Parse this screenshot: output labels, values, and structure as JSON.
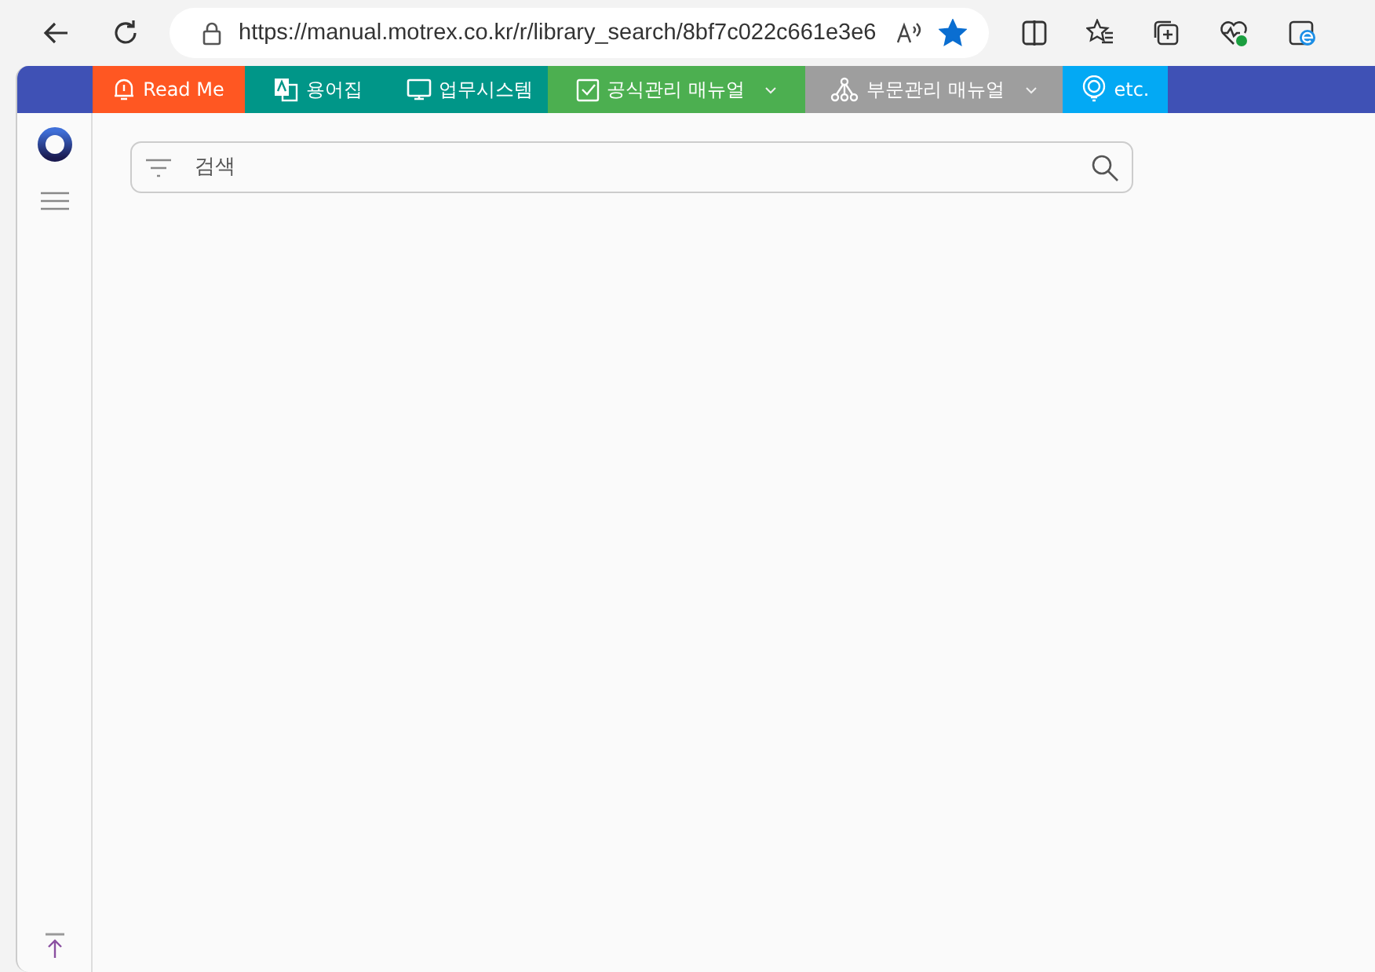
{
  "browser": {
    "url": "https://manual.motrex.co.kr/r/library_search/8bf7c022c661e3e6",
    "favorite": true
  },
  "nav_tabs": [
    {
      "label": "Read Me",
      "color": "#ff5722",
      "dropdown": false
    },
    {
      "label": "용어집",
      "color": "#009688",
      "dropdown": false
    },
    {
      "label": "업무시스템",
      "color": "#009688",
      "dropdown": false
    },
    {
      "label": "공식관리 매뉴얼",
      "color": "#4caf50",
      "dropdown": true
    },
    {
      "label": "부문관리 매뉴얼",
      "color": "#9e9e9e",
      "dropdown": true
    },
    {
      "label": "etc.",
      "color": "#03a9f4",
      "dropdown": false
    }
  ],
  "search": {
    "placeholder": "검색"
  }
}
